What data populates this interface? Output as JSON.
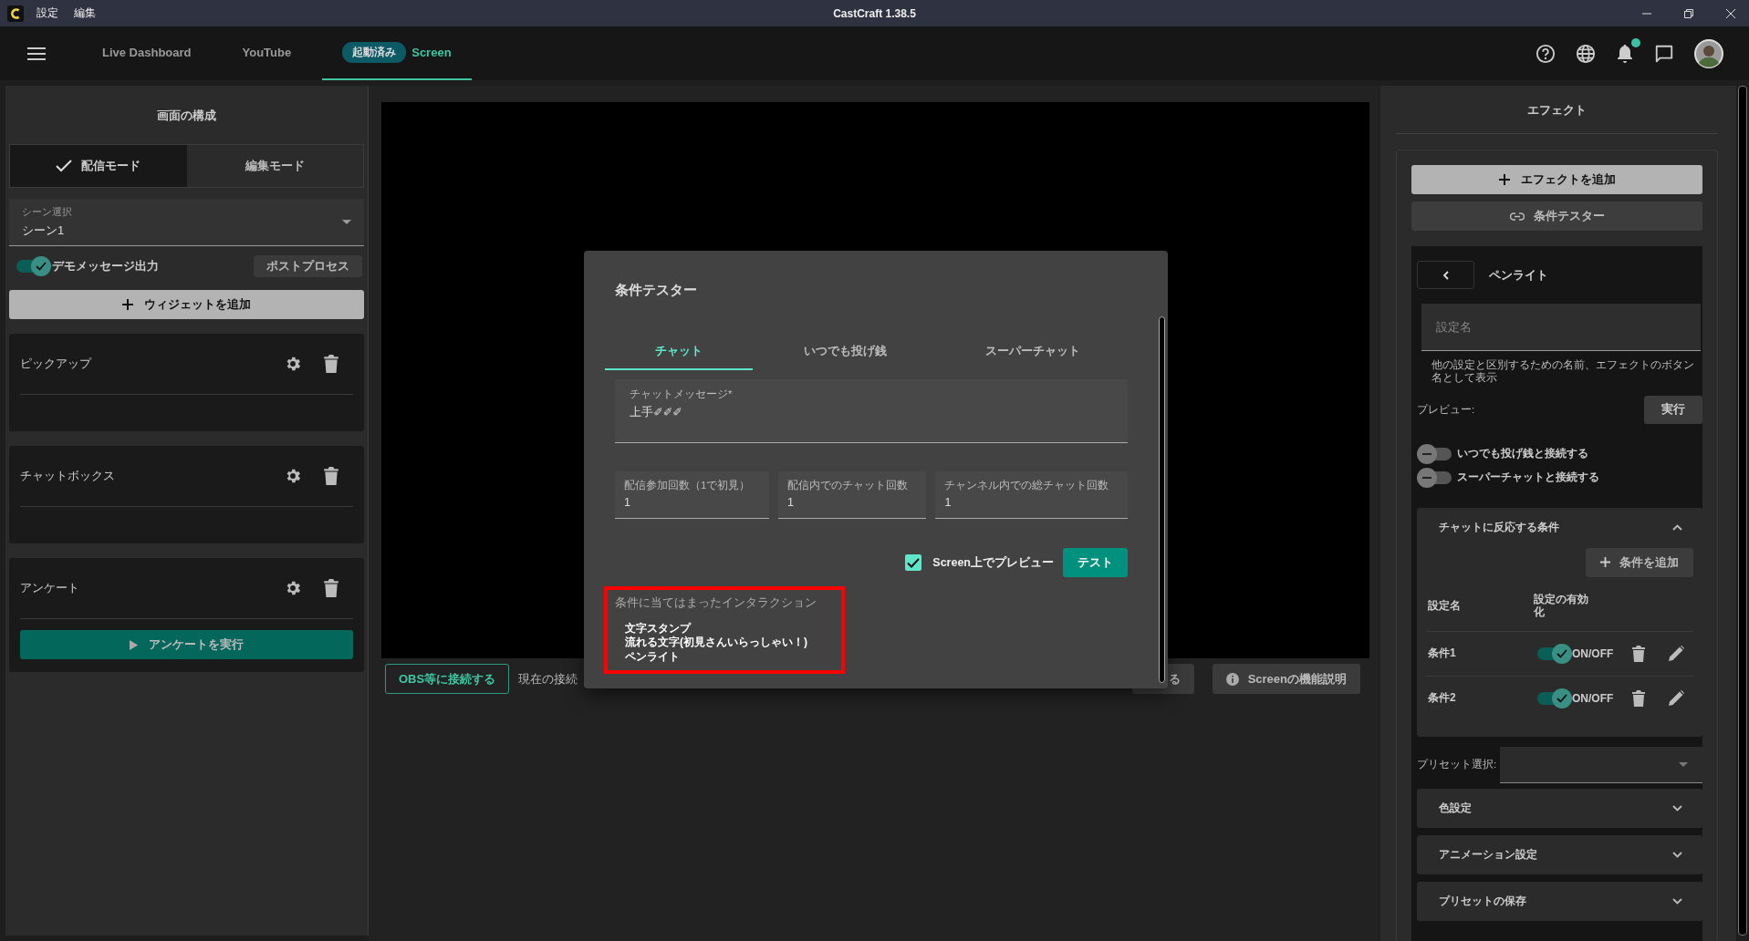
{
  "window": {
    "menu": [
      "設定",
      "編集"
    ],
    "title": "CastCraft 1.38.5"
  },
  "nav": {
    "tabs": [
      {
        "label": "Live Dashboard",
        "selected": false
      },
      {
        "label": "YouTube",
        "selected": false
      },
      {
        "label": "Screen",
        "badge": "起動済み",
        "selected": true
      }
    ],
    "notification_dot": true
  },
  "left_panel": {
    "title": "画面の構成",
    "modes": [
      {
        "label": "配信モード",
        "selected": true
      },
      {
        "label": "編集モード",
        "selected": false
      }
    ],
    "scene_select": {
      "label": "シーン選択",
      "value": "シーン1"
    },
    "demo_toggle": {
      "label": "デモメッセージ出力",
      "on": true
    },
    "postprocess_button": "ポストプロセス",
    "add_widget_button": "ウィジェットを追加",
    "widgets": [
      {
        "name": "ピックアップ"
      },
      {
        "name": "チャットボックス"
      },
      {
        "name": "アンケート",
        "action": "アンケートを実行"
      }
    ]
  },
  "bottom_bar": {
    "connect_button": "OBS等に接続する",
    "connection_text": "現在の接続",
    "hidden_button": "る",
    "help_button": "Screenの機能説明"
  },
  "dialog": {
    "title": "条件テスター",
    "tabs": [
      {
        "label": "チャット",
        "selected": true
      },
      {
        "label": "いつでも投げ銭",
        "selected": false
      },
      {
        "label": "スーパーチャット",
        "selected": false
      }
    ],
    "message_field": {
      "label": "チャットメッセージ*",
      "value": "上手✐✐✐"
    },
    "count_fields": [
      {
        "label": "配信参加回数（1で初見）",
        "value": "1"
      },
      {
        "label": "配信内でのチャット回数",
        "value": "1"
      },
      {
        "label": "チャンネル内での総チャット回数",
        "value": "1"
      }
    ],
    "preview_checkbox": {
      "label": "Screen上でプレビュー",
      "checked": true
    },
    "test_button": "テスト",
    "result": {
      "title": "条件に当てはまったインタラクション",
      "items": [
        "文字スタンプ",
        "流れる文字(初見さんいらっしゃい！)",
        "ペンライト"
      ],
      "highlighted": true
    }
  },
  "right_panel": {
    "title": "エフェクト",
    "add_effect_button": "エフェクトを追加",
    "tester_button": "条件テスター",
    "effect": {
      "name": "ペンライト",
      "name_field": {
        "placeholder": "設定名"
      },
      "hint": "他の設定と区別するための名前、エフェクトのボタン名として表示",
      "preview_label": "プレビュー:",
      "run_button": "実行",
      "links": [
        {
          "label": "いつでも投げ銭と接続する",
          "on": false
        },
        {
          "label": "スーパーチャットと接続する",
          "on": false
        }
      ],
      "conditions": {
        "title": "チャットに反応する条件",
        "expanded": true,
        "add_button": "条件を追加",
        "columns": [
          "設定名",
          "設定の有効化"
        ],
        "rows": [
          {
            "name": "条件1",
            "on": true,
            "toggle_label": "ON/OFF"
          },
          {
            "name": "条件2",
            "on": true,
            "toggle_label": "ON/OFF"
          }
        ]
      },
      "preset_label": "プリセット選択:",
      "sections": [
        {
          "title": "色設定",
          "expanded": false
        },
        {
          "title": "アニメーション設定",
          "expanded": false
        },
        {
          "title": "プリセットの保存",
          "expanded": false
        }
      ]
    }
  }
}
